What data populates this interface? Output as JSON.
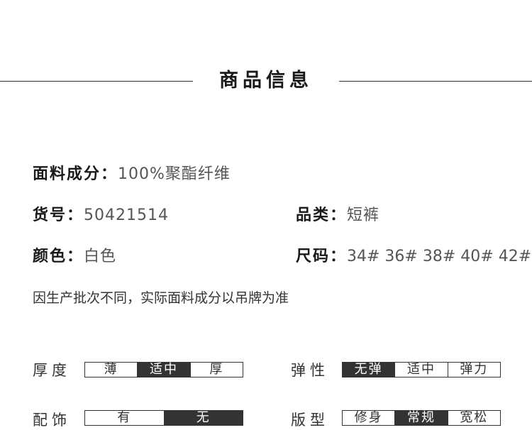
{
  "header": {
    "title": "商品信息"
  },
  "specs": {
    "fabric": {
      "label": "面料成分：",
      "value": "100%聚酯纤维"
    },
    "item_no": {
      "label": "货号：",
      "value": "50421514"
    },
    "category": {
      "label": "品类：",
      "value": "短裤"
    },
    "color": {
      "label": "颜色：",
      "value": "白色"
    },
    "size": {
      "label": "尺码：",
      "value": "34# 36# 38# 40# 42#"
    }
  },
  "note": "因生产批次不同，实际面料成分以吊牌为准",
  "ratings": {
    "thickness": {
      "label": "厚度",
      "options": [
        "薄",
        "适中",
        "厚"
      ],
      "selected": "适中"
    },
    "elasticity": {
      "label": "弹性",
      "options": [
        "无弹",
        "适中",
        "弹力"
      ],
      "selected": "无弹"
    },
    "accessories": {
      "label": "配饰",
      "options": [
        "有",
        "无"
      ],
      "selected": "无"
    },
    "fit": {
      "label": "版型",
      "options": [
        "修身",
        "常规",
        "宽松"
      ],
      "selected": "常规"
    }
  },
  "colors": {
    "line": "#333333",
    "selected_fill": "#333333"
  }
}
